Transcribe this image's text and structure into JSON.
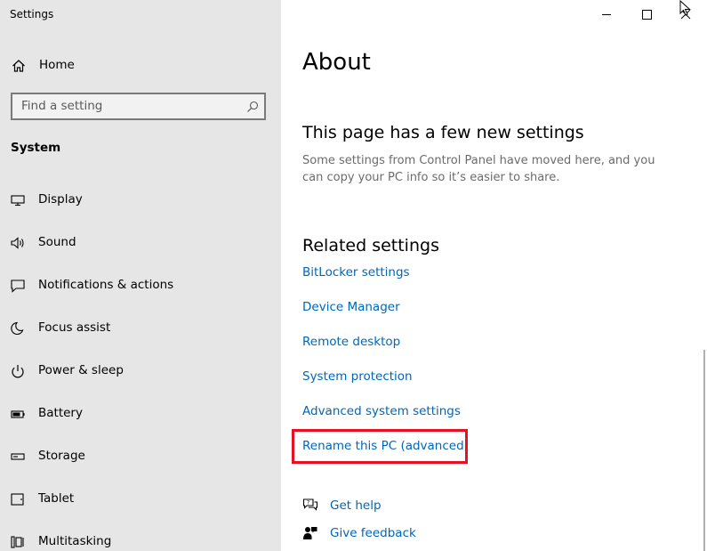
{
  "window": {
    "title": "Settings"
  },
  "sidebar": {
    "home_label": "Home",
    "search": {
      "placeholder": "Find a setting"
    },
    "section_title": "System",
    "items": [
      {
        "label": "Display",
        "icon": "monitor-icon"
      },
      {
        "label": "Sound",
        "icon": "speaker-icon"
      },
      {
        "label": "Notifications & actions",
        "icon": "notification-icon"
      },
      {
        "label": "Focus assist",
        "icon": "moon-icon"
      },
      {
        "label": "Power & sleep",
        "icon": "power-icon"
      },
      {
        "label": "Battery",
        "icon": "battery-icon"
      },
      {
        "label": "Storage",
        "icon": "storage-icon"
      },
      {
        "label": "Tablet",
        "icon": "tablet-icon"
      },
      {
        "label": "Multitasking",
        "icon": "multitasking-icon"
      }
    ]
  },
  "main": {
    "title": "About",
    "new_settings": {
      "heading": "This page has a few new settings",
      "description": "Some settings from Control Panel have moved here, and you can copy your PC info so it’s easier to share."
    },
    "related": {
      "heading": "Related settings",
      "links": [
        "BitLocker settings",
        "Device Manager",
        "Remote desktop",
        "System protection",
        "Advanced system settings",
        "Rename this PC (advanced)"
      ]
    },
    "help": {
      "get_help": "Get help",
      "give_feedback": "Give feedback"
    }
  },
  "colors": {
    "sidebar_bg": "#e6e6e6",
    "link": "#0067b8",
    "highlight": "#e81123"
  }
}
